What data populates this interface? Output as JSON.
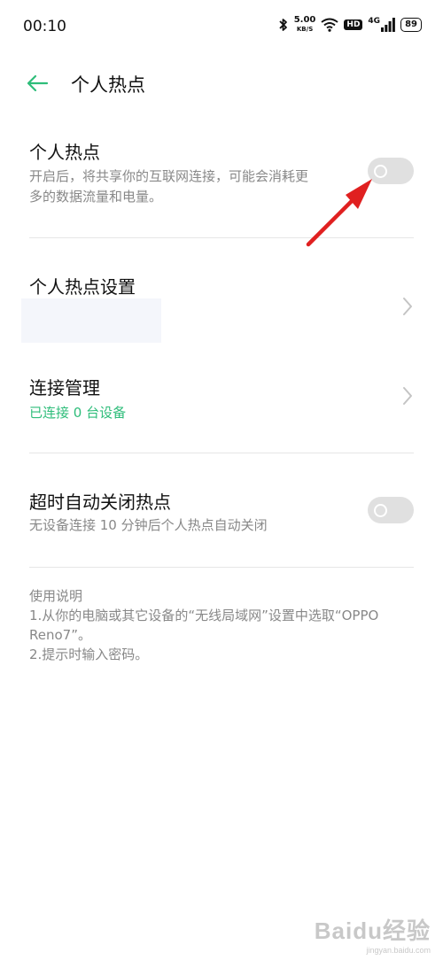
{
  "status_bar": {
    "time": "00:10",
    "net_speed": "5.00",
    "net_speed_unit": "KB/S",
    "hd_label": "HD",
    "network_type": "4G",
    "battery": "89"
  },
  "header": {
    "title": "个人热点"
  },
  "hotspot": {
    "title": "个人热点",
    "description_line1": "开启后，将共享你的互联网连接，可能会消耗更",
    "description_line2": "多的数据流量和电量。",
    "enabled": false
  },
  "hotspot_settings": {
    "title": "个人热点设置"
  },
  "connection_management": {
    "title": "连接管理",
    "status": "已连接 0 台设备"
  },
  "auto_off": {
    "title": "超时自动关闭热点",
    "description": "无设备连接 10 分钟后个人热点自动关闭",
    "enabled": false
  },
  "instructions": {
    "title": "使用说明",
    "step1_line1": "1.从你的电脑或其它设备的“无线局域网”设置中选取“OPPO",
    "step1_line2": "Reno7”。",
    "step2": "2.提示时输入密码。"
  },
  "watermark": {
    "main": "Baidu经验",
    "sub": "jingyan.baidu.com"
  },
  "colors": {
    "accent": "#2ebd7a",
    "annotation_arrow": "#e02020",
    "toggle_off": "#e0e0e0"
  }
}
